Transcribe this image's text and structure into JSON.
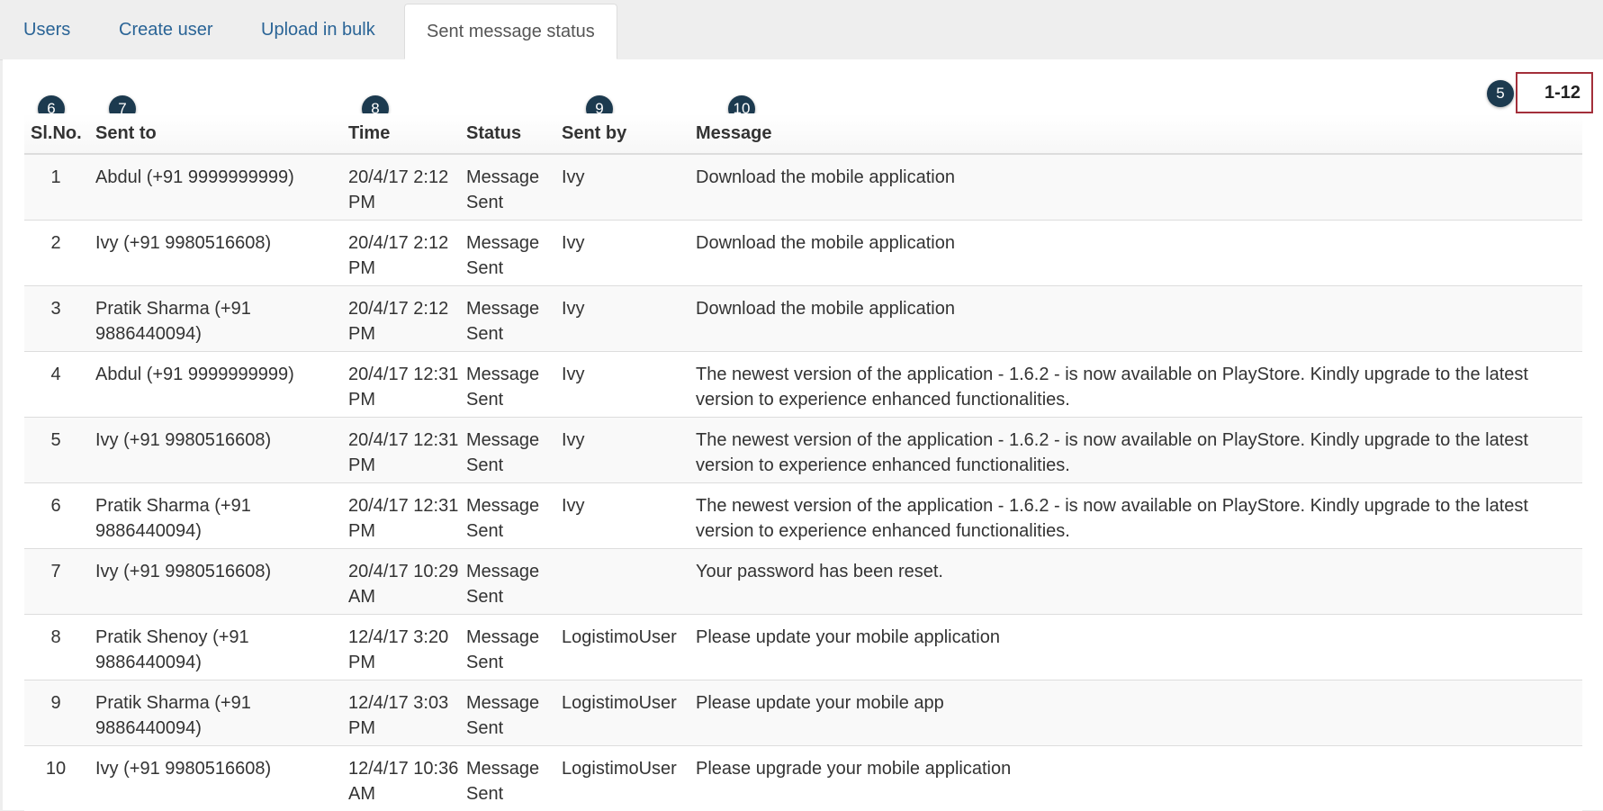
{
  "tabs": [
    {
      "label": "Users",
      "active": false
    },
    {
      "label": "Create user",
      "active": false
    },
    {
      "label": "Upload in bulk",
      "active": false
    },
    {
      "label": "Sent message status",
      "active": true
    }
  ],
  "pager": {
    "range": "1-12"
  },
  "callouts": {
    "pager": "5",
    "col_slno": "6",
    "col_sent_to": "7",
    "col_time": "8",
    "col_sent_by": "9",
    "col_message": "10"
  },
  "table": {
    "headers": {
      "slno": "Sl.No.",
      "sent_to": "Sent to",
      "time": "Time",
      "status": "Status",
      "sent_by": "Sent by",
      "message": "Message"
    },
    "rows": [
      {
        "slno": "1",
        "sent_to": "Abdul (+91 9999999999)",
        "time": "20/4/17 2:12 PM",
        "status": "Message Sent",
        "sent_by": "Ivy",
        "message": "Download the mobile application"
      },
      {
        "slno": "2",
        "sent_to": "Ivy (+91 9980516608)",
        "time": "20/4/17 2:12 PM",
        "status": "Message Sent",
        "sent_by": "Ivy",
        "message": "Download the mobile application"
      },
      {
        "slno": "3",
        "sent_to": "Pratik Sharma (+91 9886440094)",
        "time": "20/4/17 2:12 PM",
        "status": "Message Sent",
        "sent_by": "Ivy",
        "message": "Download the mobile application"
      },
      {
        "slno": "4",
        "sent_to": "Abdul (+91 9999999999)",
        "time": "20/4/17 12:31 PM",
        "status": "Message Sent",
        "sent_by": "Ivy",
        "message": "The newest version of the application - 1.6.2 - is now available on PlayStore. Kindly upgrade to the latest version to experience enhanced functionalities."
      },
      {
        "slno": "5",
        "sent_to": "Ivy (+91 9980516608)",
        "time": "20/4/17 12:31 PM",
        "status": "Message Sent",
        "sent_by": "Ivy",
        "message": "The newest version of the application - 1.6.2 - is now available on PlayStore. Kindly upgrade to the latest version to experience enhanced functionalities."
      },
      {
        "slno": "6",
        "sent_to": "Pratik Sharma (+91 9886440094)",
        "time": "20/4/17 12:31 PM",
        "status": "Message Sent",
        "sent_by": "Ivy",
        "message": "The newest version of the application - 1.6.2 - is now available on PlayStore. Kindly upgrade to the latest version to experience enhanced functionalities."
      },
      {
        "slno": "7",
        "sent_to": "Ivy (+91 9980516608)",
        "time": "20/4/17 10:29 AM",
        "status": "Message Sent",
        "sent_by": "",
        "message": "Your password has been reset."
      },
      {
        "slno": "8",
        "sent_to": "Pratik Shenoy (+91 9886440094)",
        "time": "12/4/17 3:20 PM",
        "status": "Message Sent",
        "sent_by": "LogistimoUser",
        "message": "Please update your mobile application"
      },
      {
        "slno": "9",
        "sent_to": "Pratik Sharma (+91 9886440094)",
        "time": "12/4/17 3:03 PM",
        "status": "Message Sent",
        "sent_by": "LogistimoUser",
        "message": "Please update your mobile app"
      },
      {
        "slno": "10",
        "sent_to": "Ivy (+91 9980516608)",
        "time": "12/4/17 10:36 AM",
        "status": "Message Sent",
        "sent_by": "LogistimoUser",
        "message": "Please upgrade your mobile application"
      }
    ]
  }
}
